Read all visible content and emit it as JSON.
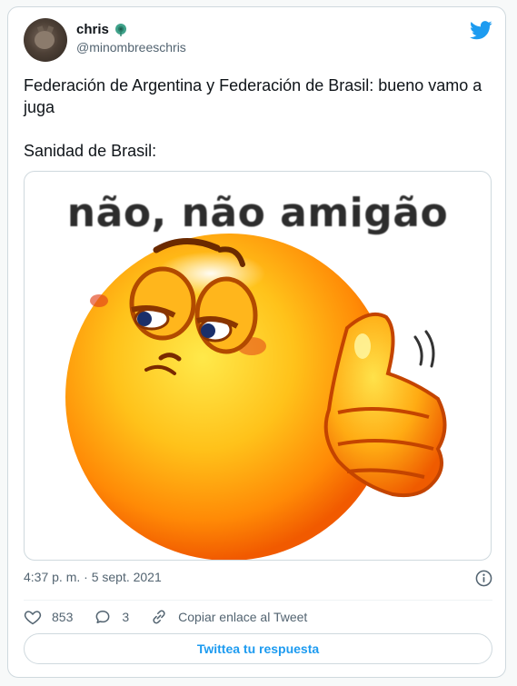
{
  "user": {
    "name": "chris",
    "handle": "@minombreeschris",
    "badge_icon": "peacock-emoji-icon"
  },
  "tweet": {
    "text": "Federación de Argentina y Federación de Brasil: bueno vamo a juga\n\nSanidad de Brasil:"
  },
  "media": {
    "caption": "não, não amigão",
    "description_icon": "smug-emoji-thumbs-up-icon"
  },
  "timestamp": "4:37 p. m. · 5 sept. 2021",
  "actions": {
    "likes": "853",
    "replies": "3",
    "copy_link": "Copiar enlace al Tweet"
  },
  "reply_button": "Twittea tu respuesta",
  "colors": {
    "brand": "#1d9bf0",
    "text": "#0f1419",
    "secondary": "#536471",
    "border": "#cfd9de"
  }
}
